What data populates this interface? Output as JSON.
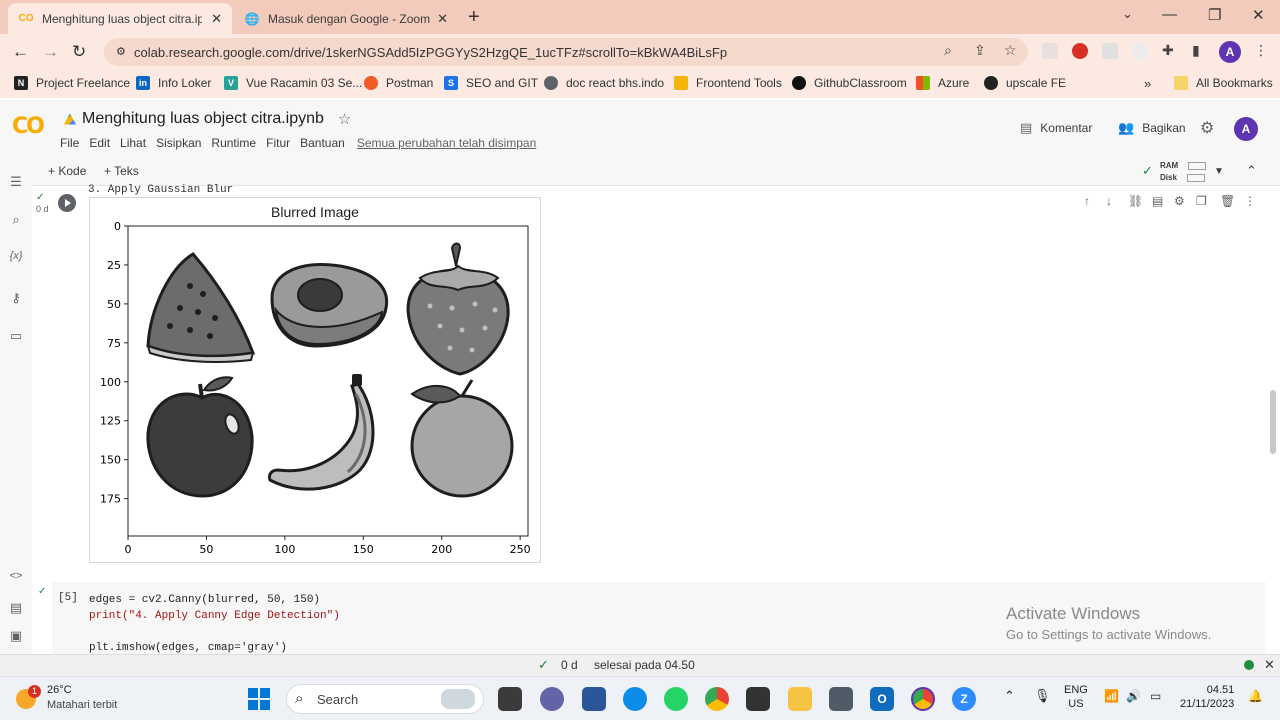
{
  "browser": {
    "tabs": [
      {
        "title": "Menghitung luas object citra.ipy"
      },
      {
        "title": "Masuk dengan Google - Zoom"
      }
    ],
    "url": "colab.research.google.com/drive/1skerNGSAdd5IzPGGYyS2HzgQE_1ucTFz#scrollTo=kBkWA4BiLsFp",
    "profile_initial": "A",
    "bookmarks": [
      "Project Freelance",
      "Info Loker",
      "Vue Racamin 03 Se...",
      "Postman",
      "SEO and GIT",
      "doc react bhs.indo",
      "Froontend Tools",
      "GithubClassroom",
      "Azure",
      "upscale FE"
    ],
    "all_bookmarks": "All Bookmarks"
  },
  "colab": {
    "logo": "CO",
    "notebook_title": "Menghitung luas object citra.ipynb",
    "menu": [
      "File",
      "Edit",
      "Lihat",
      "Sisipkan",
      "Runtime",
      "Fitur",
      "Bantuan"
    ],
    "saved_status": "Semua perubahan telah disimpan",
    "comment_label": "Komentar",
    "share_label": "Bagikan",
    "user_initial": "A",
    "add_code": "+ Kode",
    "add_text": "+ Teks",
    "ram_label": "RAM",
    "disk_label": "Disk",
    "cell1_status": "0 d",
    "cell1_cut_text": "3. Apply Gaussian Blur",
    "cell2_number": "[5]",
    "cell2_lines": [
      "edges = cv2.Canny(blurred, 50, 150)",
      "print(\"4. Apply Canny Edge Detection\")",
      "",
      "plt.imshow(edges, cmap='gray')"
    ],
    "status_time": "0 d",
    "status_done": "selesai pada 04.50"
  },
  "chart_data": {
    "type": "image",
    "title": "Blurred Image",
    "x_ticks": [
      0,
      50,
      100,
      150,
      200,
      250
    ],
    "y_ticks": [
      0,
      25,
      50,
      75,
      100,
      125,
      150,
      175
    ],
    "xlim": [
      0,
      255
    ],
    "ylim": [
      199,
      0
    ],
    "objects": [
      "watermelon",
      "avocado",
      "strawberry",
      "apple",
      "banana",
      "orange"
    ]
  },
  "watermark": {
    "line1": "Activate Windows",
    "line2": "Go to Settings to activate Windows."
  },
  "taskbar": {
    "weather_temp": "26°C",
    "weather_desc": "Matahari terbit",
    "weather_badge": "1",
    "search_placeholder": "Search",
    "lang_top": "ENG",
    "lang_bottom": "US",
    "time": "04.51",
    "date": "21/11/2023"
  }
}
